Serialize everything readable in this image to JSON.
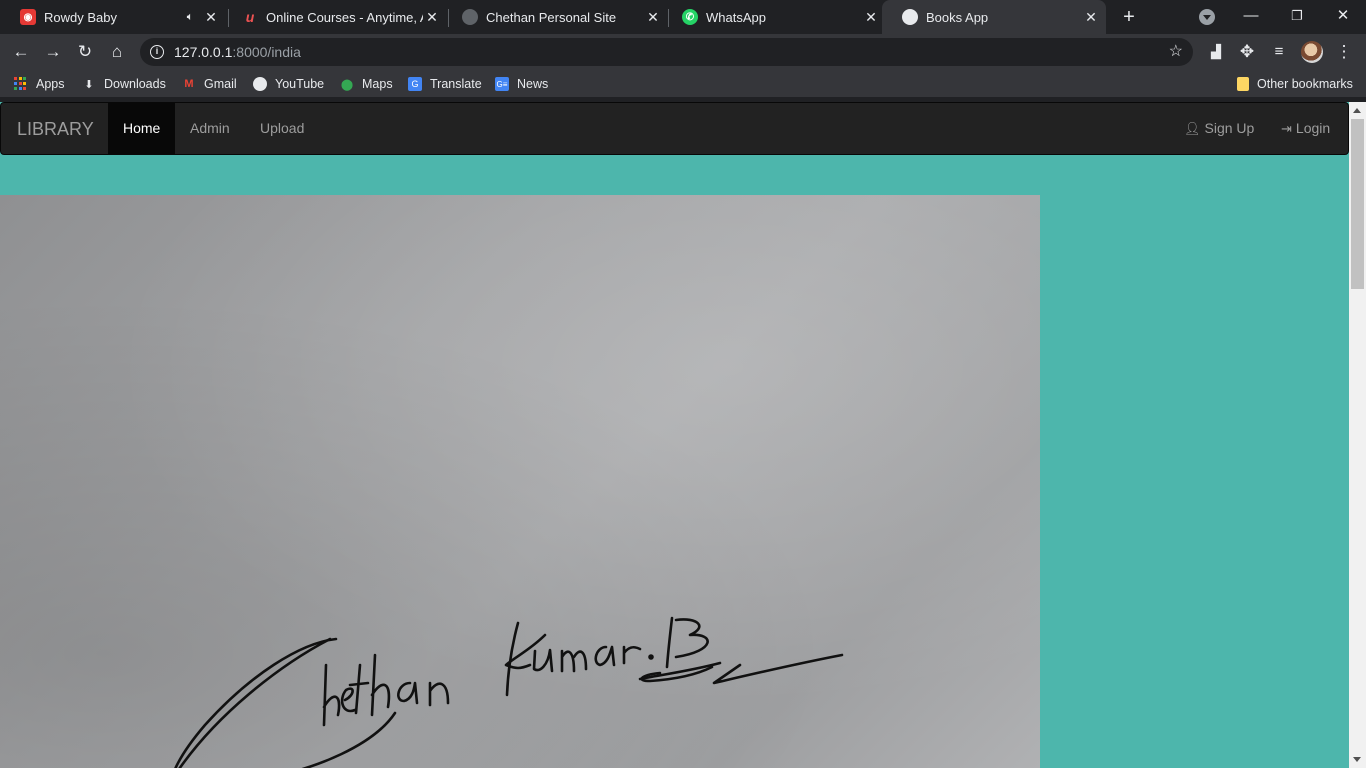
{
  "browser": {
    "tabs": [
      {
        "title": "Rowdy Baby",
        "icon": "youtube-music-icon",
        "audio": true
      },
      {
        "title": "Online Courses - Anytime, Anywhere",
        "icon": "udemy-icon",
        "audio": false
      },
      {
        "title": "Chethan Personal Site",
        "icon": "globe-icon",
        "audio": false
      },
      {
        "title": "WhatsApp",
        "icon": "whatsapp-icon",
        "audio": false
      },
      {
        "title": "Books App",
        "icon": "globe-icon",
        "audio": false,
        "active": true
      }
    ],
    "url_host": "127.0.0.1",
    "url_rest": ":8000/india",
    "bookmarks": [
      {
        "label": "Apps",
        "icon": "apps-grid-icon"
      },
      {
        "label": "Downloads",
        "icon": "download-icon"
      },
      {
        "label": "Gmail",
        "icon": "gmail-icon"
      },
      {
        "label": "YouTube",
        "icon": "globe-icon"
      },
      {
        "label": "Maps",
        "icon": "maps-pin-icon"
      },
      {
        "label": "Translate",
        "icon": "translate-icon"
      },
      {
        "label": "News",
        "icon": "news-icon"
      }
    ],
    "other_bookmarks": "Other bookmarks"
  },
  "navbar": {
    "brand": "LIBRARY",
    "links": [
      {
        "label": "Home",
        "active": true
      },
      {
        "label": "Admin"
      },
      {
        "label": "Upload"
      }
    ],
    "sign_up": "Sign Up",
    "login": "Login"
  },
  "colors": {
    "page_background": "#4db6ac",
    "navbar_background": "#222222",
    "navbar_active": "#080808"
  }
}
